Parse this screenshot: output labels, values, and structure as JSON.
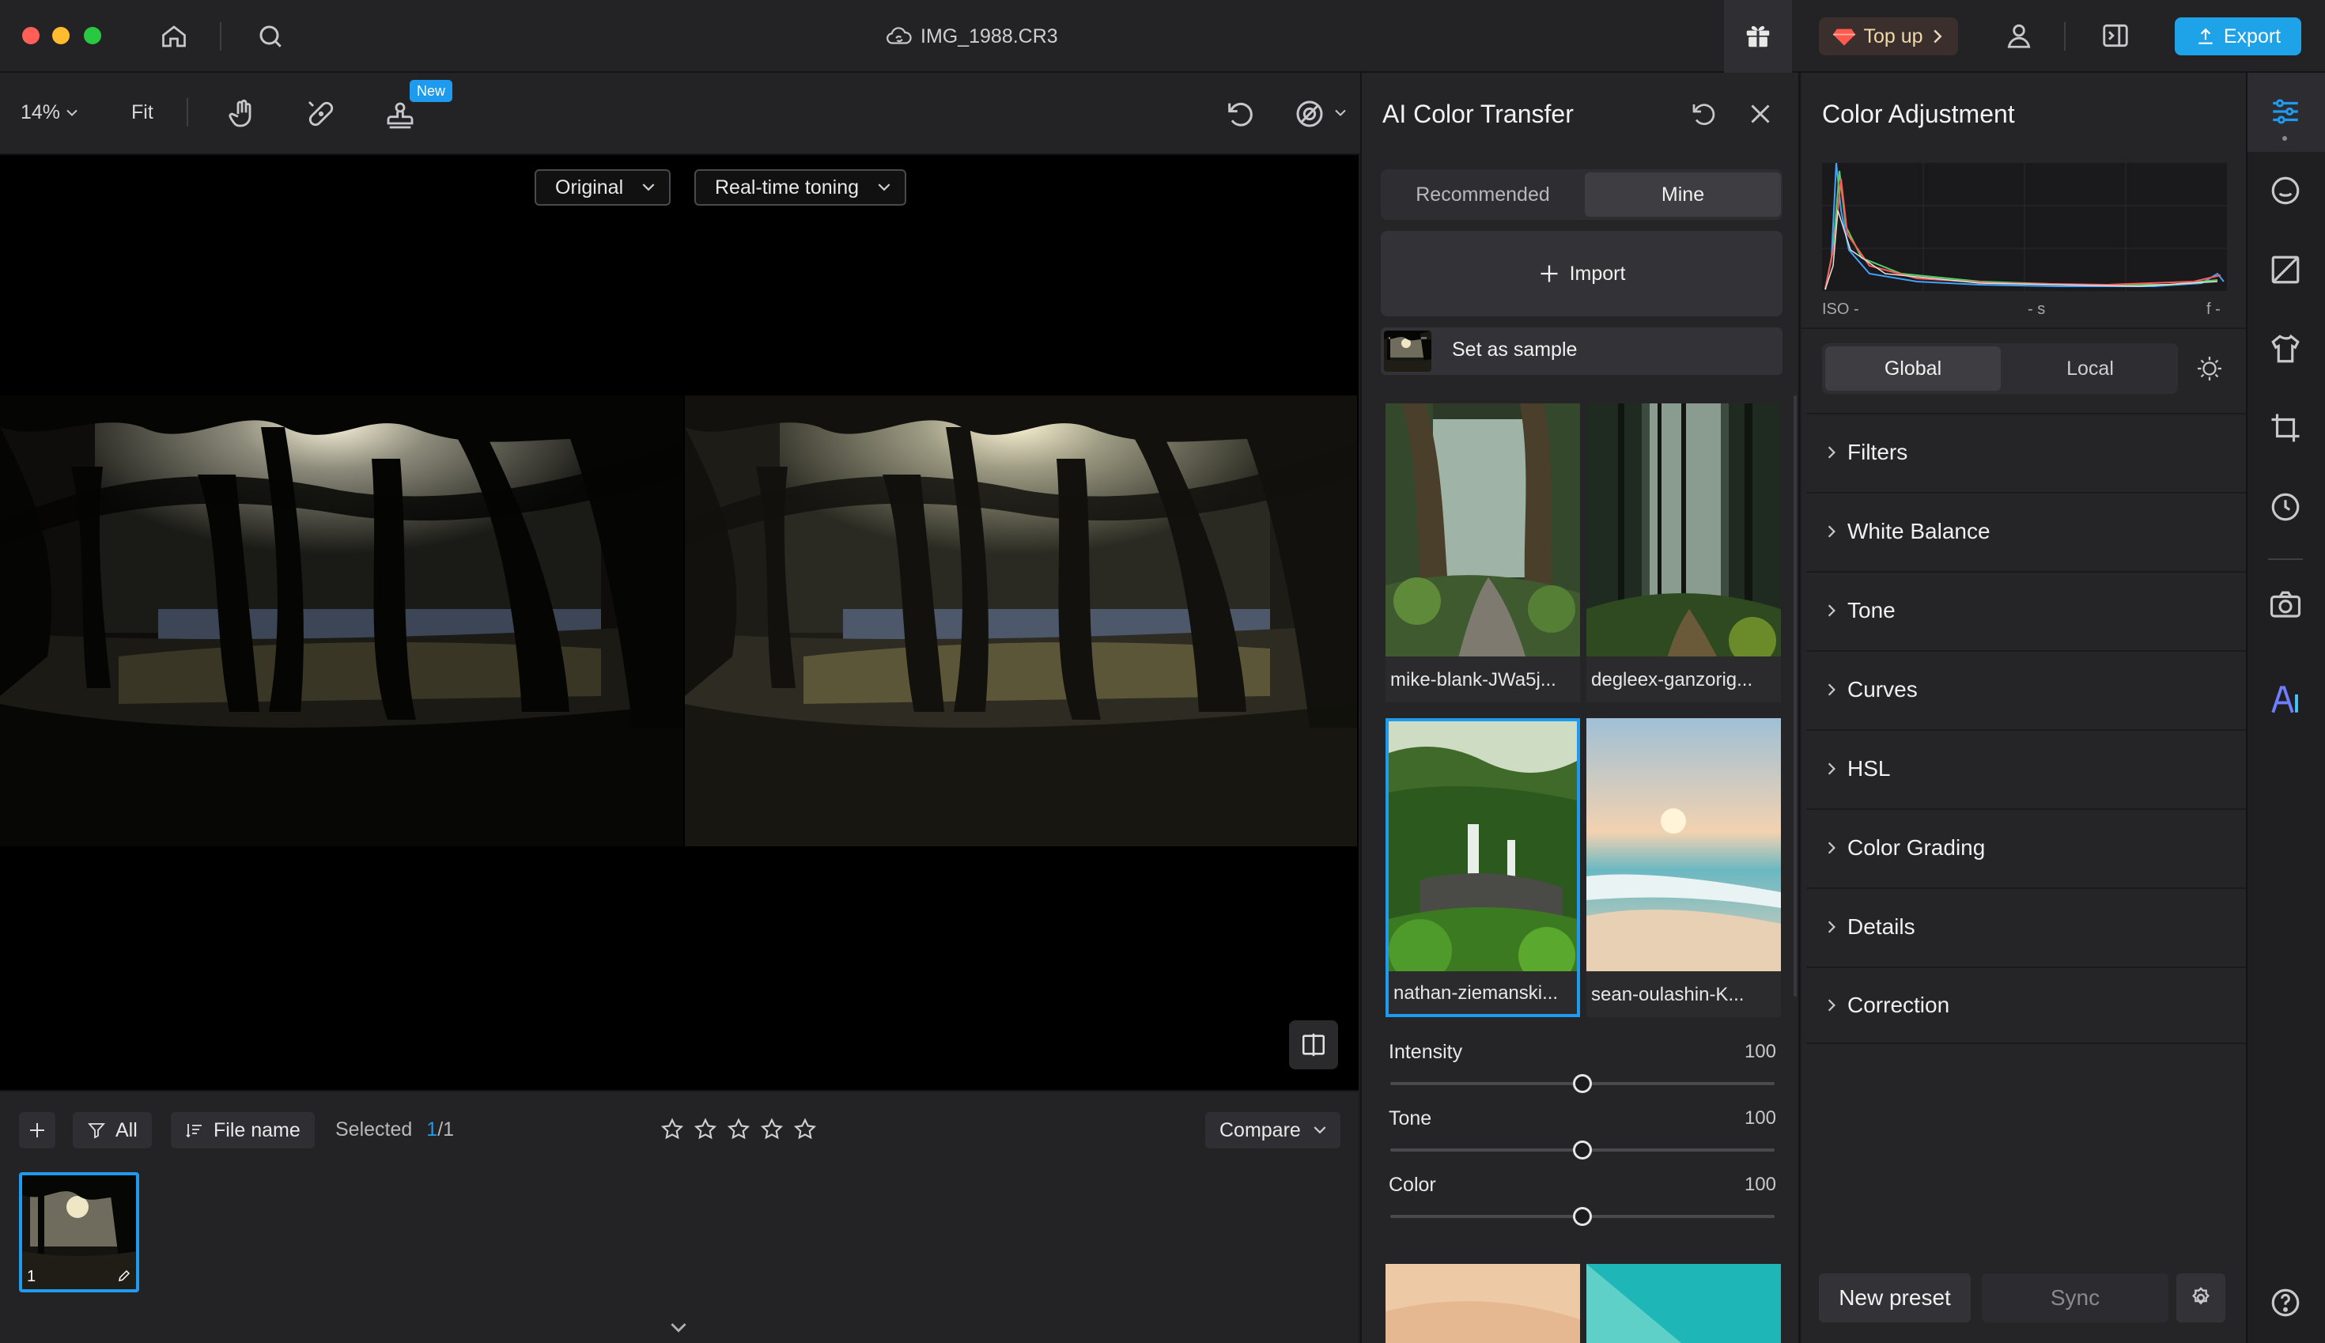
{
  "window": {
    "file_name": "IMG_1988.CR3",
    "top_up_label": "Top up",
    "export_label": "Export"
  },
  "toolbar": {
    "zoom": "14%",
    "fit_label": "Fit",
    "new_badge": "New"
  },
  "canvas": {
    "left_dropdown": "Original",
    "right_dropdown": "Real-time toning"
  },
  "bottom": {
    "filter_label": "All",
    "sort_label": "File name",
    "selected_label": "Selected",
    "selected_count": "1",
    "selected_total": "/1",
    "compare_label": "Compare",
    "thumb_index": "1",
    "rating_stars": 0
  },
  "ai_panel": {
    "title": "AI Color Transfer",
    "tabs": [
      "Recommended",
      "Mine"
    ],
    "active_tab": "Mine",
    "import_label": "Import",
    "set_sample_label": "Set as sample",
    "presets": [
      {
        "name": "mike-blank-JWa5j..."
      },
      {
        "name": "degleex-ganzorig..."
      },
      {
        "name": "nathan-ziemanski...",
        "selected": true
      },
      {
        "name": "sean-oulashin-K..."
      }
    ],
    "sliders": [
      {
        "label": "Intensity",
        "value": "100"
      },
      {
        "label": "Tone",
        "value": "100"
      },
      {
        "label": "Color",
        "value": "100"
      }
    ]
  },
  "adjust_panel": {
    "title": "Color Adjustment",
    "histogram": {
      "iso": "ISO -",
      "shutter": "- s",
      "aperture": "f -"
    },
    "modes": [
      "Global",
      "Local"
    ],
    "active_mode": "Global",
    "sections": [
      "Filters",
      "White Balance",
      "Tone",
      "Curves",
      "HSL",
      "Color Grading",
      "Details",
      "Correction"
    ],
    "new_preset_label": "New preset",
    "sync_label": "Sync"
  },
  "colors": {
    "accent": "#1e9bef",
    "export": "#1fa3e8",
    "panel": "#252528"
  }
}
